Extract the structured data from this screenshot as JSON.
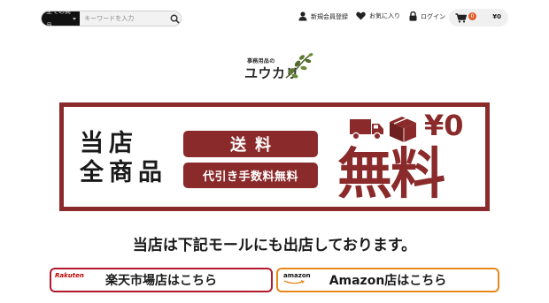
{
  "header": {
    "search": {
      "category_label": "全ての商品",
      "placeholder": "キーワードを入力",
      "search_icon": "search-icon"
    },
    "nav": {
      "register_label": "新規会員登録",
      "favorites_label": "お気に入り",
      "login_label": "ログイン"
    },
    "cart": {
      "count": "0",
      "total": "¥0"
    }
  },
  "logo": {
    "sub": "事務用品の",
    "main": "ユウカリ"
  },
  "banner": {
    "left_line1": "当店",
    "left_line2": "全商品",
    "shipping_label": "送料",
    "cod_label": "代引き手数料無料",
    "price": "¥0",
    "free_label": "無料"
  },
  "malls": {
    "heading": "当店は下記モールにも出店しております。",
    "rakuten_label": "楽天市場店はこちら",
    "rakuten_logo": "Rakuten",
    "amazon_label": "Amazon店はこちら",
    "amazon_logo": "amazon"
  },
  "colors": {
    "brand": "#8a2a2a",
    "rakuten": "#b21a2b",
    "amazon": "#e8881a",
    "badge": "#e05a2a"
  }
}
